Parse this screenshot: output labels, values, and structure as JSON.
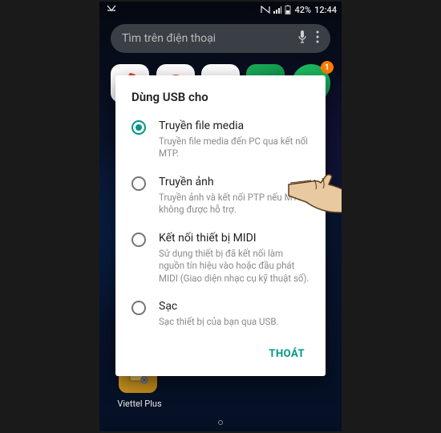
{
  "status": {
    "battery_pct": "42%",
    "time": "12:44"
  },
  "search": {
    "placeholder": "Tìm trên điện thoại"
  },
  "apps": {
    "badge_count": "1"
  },
  "dialog": {
    "title": "Dùng USB cho",
    "options": [
      {
        "title": "Truyền file media",
        "desc": "Truyền file media đến PC qua kết nối MTP.",
        "selected": true
      },
      {
        "title": "Truyền ảnh",
        "desc": "Truyền ảnh và kết nối PTP nếu MTP không được hỗ trợ.",
        "selected": false
      },
      {
        "title": "Kết nối thiết bị MIDI",
        "desc": "Sử dụng thiết bị đã kết nối làm nguồn tín hiệu vào hoặc đầu phát MIDI (Giao diện nhạc cụ kỹ thuật số).",
        "selected": false
      },
      {
        "title": "Sạc",
        "desc": "Sạc thiết bị của bạn qua USB.",
        "selected": false
      }
    ],
    "exit_label": "THOÁT"
  },
  "home": {
    "app_label": "Viettel Plus"
  }
}
